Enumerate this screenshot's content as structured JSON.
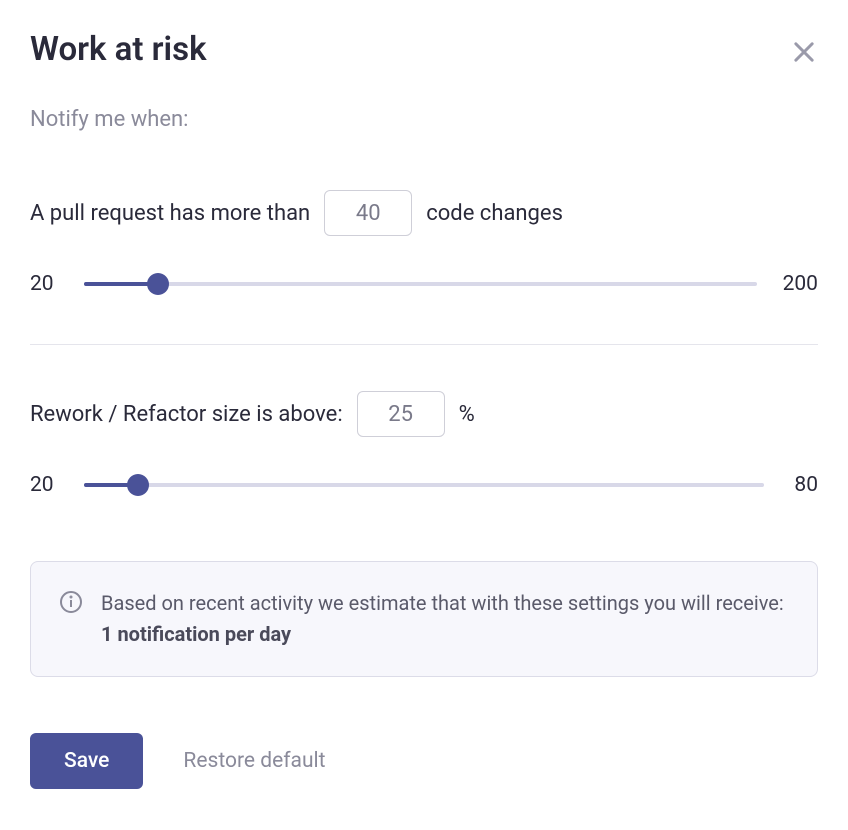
{
  "header": {
    "title": "Work at risk"
  },
  "subtitle": "Notify me when:",
  "pullRequest": {
    "prefix": "A pull request has more than",
    "value": "40",
    "suffix": "code changes",
    "slider": {
      "min": "20",
      "max": "200",
      "fillPercent": "11",
      "thumbPercent": "11"
    }
  },
  "rework": {
    "prefix": "Rework / Refactor size is above:",
    "value": "25",
    "suffix": "%",
    "slider": {
      "min": "20",
      "max": "80",
      "fillPercent": "8",
      "thumbPercent": "8"
    }
  },
  "info": {
    "textBefore": "Based on recent activity we estimate that with these settings you will receive: ",
    "bold": "1 notification per day"
  },
  "buttons": {
    "save": "Save",
    "restore": "Restore default"
  }
}
